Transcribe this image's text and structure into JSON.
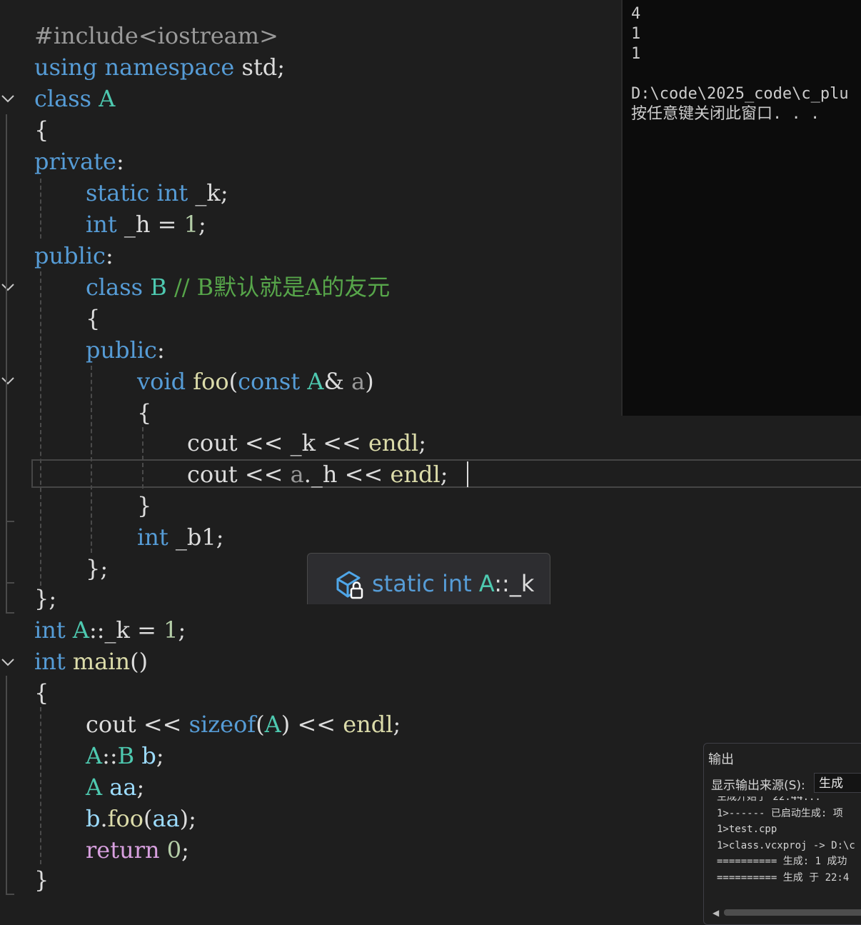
{
  "editor": {
    "code_lines": [
      "#include<iostream>",
      "using namespace std;",
      "class A",
      "{",
      "private:",
      "static int _k;",
      "int _h = 1;",
      "public:",
      "class B // B默认就是A的友元",
      "{",
      "public:",
      "void foo(const A& a)",
      "{",
      "cout << _k << endl;",
      "cout << a._h << endl;",
      "}",
      "int _b1;",
      "};",
      "};",
      "int A::_k = 1;",
      "int main()",
      "{",
      "cout << sizeof(A) << endl;",
      "A::B b;",
      "A aa;",
      "b.foo(aa);",
      "return 0;",
      "}"
    ]
  },
  "console": {
    "lines": [
      "4",
      "1",
      "1",
      "",
      "D:\\code\\2025_code\\c_plu",
      "按任意键关闭此窗口. . ."
    ]
  },
  "tooltip": {
    "icon": "static-field-icon",
    "keyword_static": "static",
    "keyword_int": "int",
    "class_name": "A",
    "scope": "::_k"
  },
  "output_panel": {
    "title": "输出",
    "source_label": "显示输出来源(S):",
    "source_value": "生成",
    "lines": [
      "生成开始于 22:44...",
      "1>------ 已启动生成: 项",
      "1>test.cpp",
      "1>class.vcxproj -> D:\\c",
      "========== 生成: 1 成功",
      "========== 生成 于 22:4"
    ]
  },
  "colors": {
    "background": "#1e1e1e",
    "keyword": "#569cd6",
    "type": "#4ec9b0",
    "function": "#dcdcaa",
    "comment": "#57a64a",
    "control": "#d8a0df"
  }
}
